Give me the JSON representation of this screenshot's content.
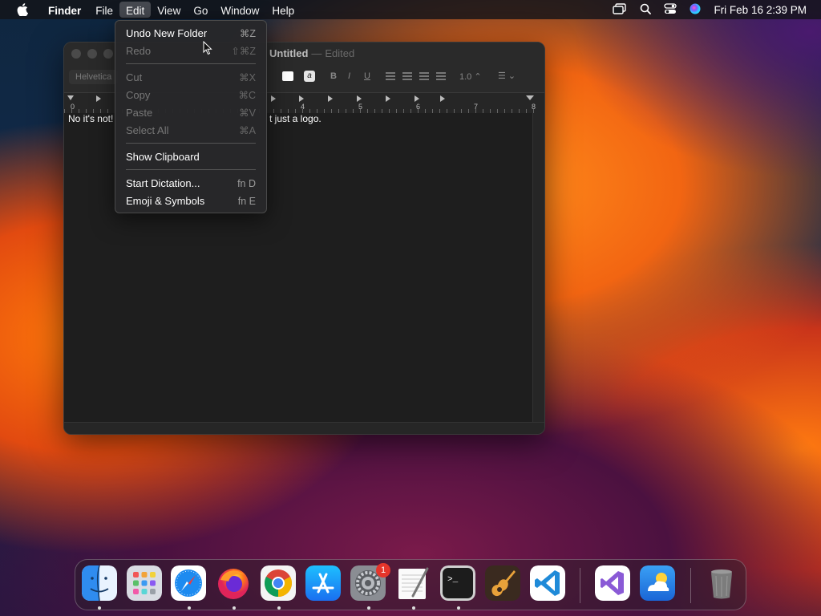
{
  "menubar": {
    "app_name": "Finder",
    "menus": [
      "File",
      "Edit",
      "View",
      "Go",
      "Window",
      "Help"
    ],
    "active_menu": "Edit",
    "clock": "Fri Feb 16  2:39 PM"
  },
  "window": {
    "title": "Untitled",
    "title_separator": "—",
    "title_status": "Edited",
    "font_popup": "Helvetica",
    "format_bold": "B",
    "format_italic": "I",
    "format_underline": "U",
    "text_color_glyph": "a",
    "line_spacing": "1.0 ⌃",
    "list_button": "☰ ⌄",
    "ruler_numbers": [
      "0",
      "4",
      "5",
      "6",
      "7",
      "8"
    ],
    "text_left": "No it's not!",
    "text_right": "t just a logo."
  },
  "edit_menu": {
    "items": [
      {
        "label": "Undo New Folder",
        "shortcut": "⌘Z",
        "enabled": true
      },
      {
        "label": "Redo",
        "shortcut": "⇧⌘Z",
        "enabled": false
      },
      {
        "label": "Cut",
        "shortcut": "⌘X",
        "enabled": false
      },
      {
        "label": "Copy",
        "shortcut": "⌘C",
        "enabled": false
      },
      {
        "label": "Paste",
        "shortcut": "⌘V",
        "enabled": false
      },
      {
        "label": "Select All",
        "shortcut": "⌘A",
        "enabled": false
      },
      {
        "label": "Show Clipboard",
        "shortcut": "",
        "enabled": true
      },
      {
        "label": "Start Dictation...",
        "shortcut": "fn D",
        "enabled": true
      },
      {
        "label": "Emoji & Symbols",
        "shortcut": "fn E",
        "enabled": true
      }
    ]
  },
  "dock": {
    "apps": [
      "finder",
      "launchpad",
      "safari",
      "firefox",
      "chrome",
      "app-store",
      "system-settings",
      "textedit",
      "terminal",
      "garageband",
      "vscode",
      "visual-studio",
      "weather",
      "trash"
    ],
    "settings_badge": "1"
  }
}
